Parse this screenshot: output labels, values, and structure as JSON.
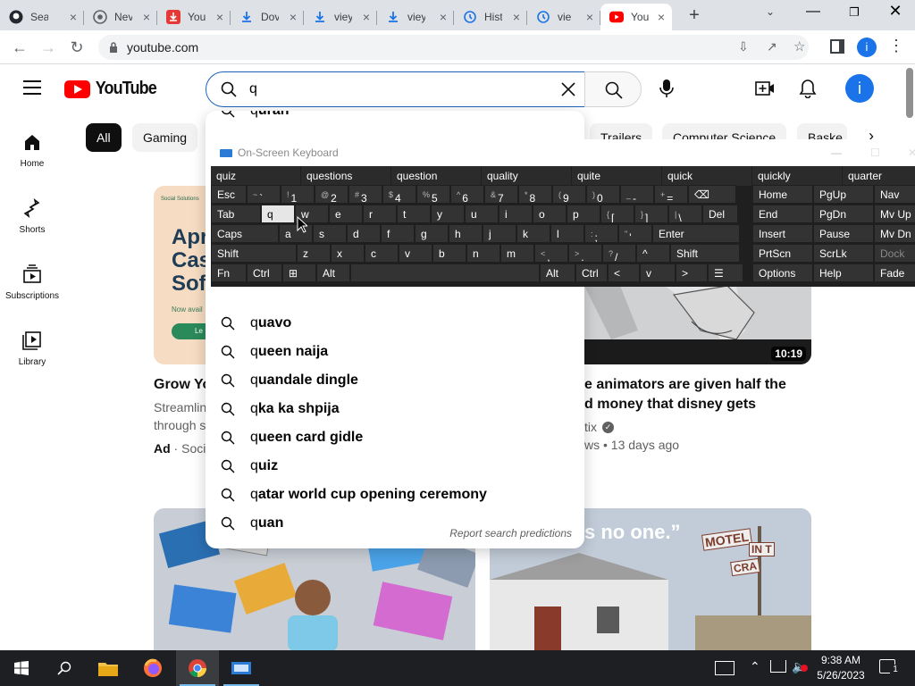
{
  "browser": {
    "tabs": [
      {
        "label": "Sea",
        "icon": "github-icon"
      },
      {
        "label": "Nev",
        "icon": "chrome-icon"
      },
      {
        "label": "You",
        "icon": "download-red-icon"
      },
      {
        "label": "Dov",
        "icon": "download-icon"
      },
      {
        "label": "viey",
        "icon": "download-icon"
      },
      {
        "label": "viey",
        "icon": "download-icon"
      },
      {
        "label": "Hist",
        "icon": "history-icon"
      },
      {
        "label": "vie",
        "icon": "history-icon"
      },
      {
        "label": "You",
        "icon": "youtube-icon",
        "active": true
      }
    ],
    "url": "youtube.com",
    "profile_initial": "i"
  },
  "youtube": {
    "logo_text": "YouTube",
    "search_value": "q",
    "avatar_initial": "i",
    "sidebar": [
      {
        "label": "Home",
        "icon": "home-icon"
      },
      {
        "label": "Shorts",
        "icon": "shorts-icon"
      },
      {
        "label": "Subscriptions",
        "icon": "subscriptions-icon"
      },
      {
        "label": "Library",
        "icon": "library-icon"
      }
    ],
    "chips": [
      "All",
      "Gaming",
      "Trailers",
      "Computer Science",
      "Baske"
    ],
    "suggestions": [
      {
        "prefix": "q",
        "rest": "uran"
      },
      {
        "prefix": "q",
        "rest": "uavo"
      },
      {
        "prefix": "q",
        "rest": "ueen naija"
      },
      {
        "prefix": "q",
        "rest": "uandale dingle"
      },
      {
        "prefix": "q",
        "rest": "ka ka shpija"
      },
      {
        "prefix": "q",
        "rest": "ueen card gidle"
      },
      {
        "prefix": "q",
        "rest": "uiz"
      },
      {
        "prefix": "q",
        "rest": "atar world cup opening ceremony"
      },
      {
        "prefix": "q",
        "rest": "uan"
      }
    ],
    "report_link": "Report search predictions",
    "ad": {
      "headline": "Grow Yo",
      "desc_1": "Streamlin",
      "desc_2": "through s",
      "ad_label": "Ad",
      "advertiser": "Soci",
      "banner_brand": "Social Solutions",
      "banner_lines": [
        "Apr",
        "Cas",
        "Soft"
      ],
      "banner_small": "Now avail",
      "banner_button": "Le"
    },
    "video": {
      "duration": "10:19",
      "title_1": "e animators are given half the",
      "title_2": "d money that disney gets",
      "channel": "tix",
      "meta": "ws • 13 days ago",
      "thumb_text": "s no one.”",
      "motel_sign_1": "MOTEL",
      "motel_sign_2": "IN T",
      "motel_sign_3": "CRA"
    }
  },
  "osk": {
    "title": "On-Screen Keyboard",
    "predictions": [
      "quiz",
      "questions",
      "question",
      "quality",
      "quite",
      "quick",
      "quickly",
      "quarter"
    ],
    "rows": [
      [
        {
          "l": "Esc"
        },
        {
          "s": "~",
          "l": "`"
        },
        {
          "s": "!",
          "l": "1"
        },
        {
          "s": "@",
          "l": "2"
        },
        {
          "s": "#",
          "l": "3"
        },
        {
          "s": "$",
          "l": "4"
        },
        {
          "s": "%",
          "l": "5"
        },
        {
          "s": "^",
          "l": "6"
        },
        {
          "s": "&",
          "l": "7"
        },
        {
          "s": "*",
          "l": "8"
        },
        {
          "s": "(",
          "l": "9"
        },
        {
          "s": ")",
          "l": "0"
        },
        {
          "s": "_",
          "l": "-"
        },
        {
          "s": "+",
          "l": "="
        },
        {
          "l": "⌫"
        }
      ],
      [
        {
          "l": "Tab"
        },
        {
          "l": "q"
        },
        {
          "l": "w"
        },
        {
          "l": "e"
        },
        {
          "l": "r"
        },
        {
          "l": "t"
        },
        {
          "l": "y"
        },
        {
          "l": "u"
        },
        {
          "l": "i"
        },
        {
          "l": "o"
        },
        {
          "l": "p"
        },
        {
          "s": "{",
          "l": "["
        },
        {
          "s": "}",
          "l": "]"
        },
        {
          "s": "|",
          "l": "\\"
        },
        {
          "l": "Del"
        }
      ],
      [
        {
          "l": "Caps"
        },
        {
          "l": "a"
        },
        {
          "l": "s"
        },
        {
          "l": "d"
        },
        {
          "l": "f"
        },
        {
          "l": "g"
        },
        {
          "l": "h"
        },
        {
          "l": "j"
        },
        {
          "l": "k"
        },
        {
          "l": "l"
        },
        {
          "s": ":",
          "l": ";"
        },
        {
          "s": "\"",
          "l": "'"
        },
        {
          "l": "Enter"
        }
      ],
      [
        {
          "l": "Shift"
        },
        {
          "l": "z"
        },
        {
          "l": "x"
        },
        {
          "l": "c"
        },
        {
          "l": "v"
        },
        {
          "l": "b"
        },
        {
          "l": "n"
        },
        {
          "l": "m"
        },
        {
          "s": "<",
          "l": ","
        },
        {
          "s": ">",
          "l": "."
        },
        {
          "s": "?",
          "l": "/"
        },
        {
          "l": "^"
        },
        {
          "l": "Shift"
        }
      ],
      [
        {
          "l": "Fn"
        },
        {
          "l": "Ctrl"
        },
        {
          "l": "⊞"
        },
        {
          "l": "Alt"
        },
        {
          "l": ""
        },
        {
          "l": "Alt"
        },
        {
          "l": "Ctrl"
        },
        {
          "l": "<"
        },
        {
          "l": "v"
        },
        {
          "l": ">"
        },
        {
          "l": "☰"
        }
      ]
    ],
    "nav_keys": [
      [
        "Home",
        "PgUp",
        "Nav"
      ],
      [
        "End",
        "PgDn",
        "Mv Up"
      ],
      [
        "Insert",
        "Pause",
        "Mv Dn"
      ],
      [
        "PrtScn",
        "ScrLk",
        "Dock"
      ],
      [
        "Options",
        "Help",
        "Fade"
      ]
    ]
  },
  "taskbar": {
    "time": "9:38 AM",
    "date": "5/26/2023",
    "notif_count": "1"
  }
}
